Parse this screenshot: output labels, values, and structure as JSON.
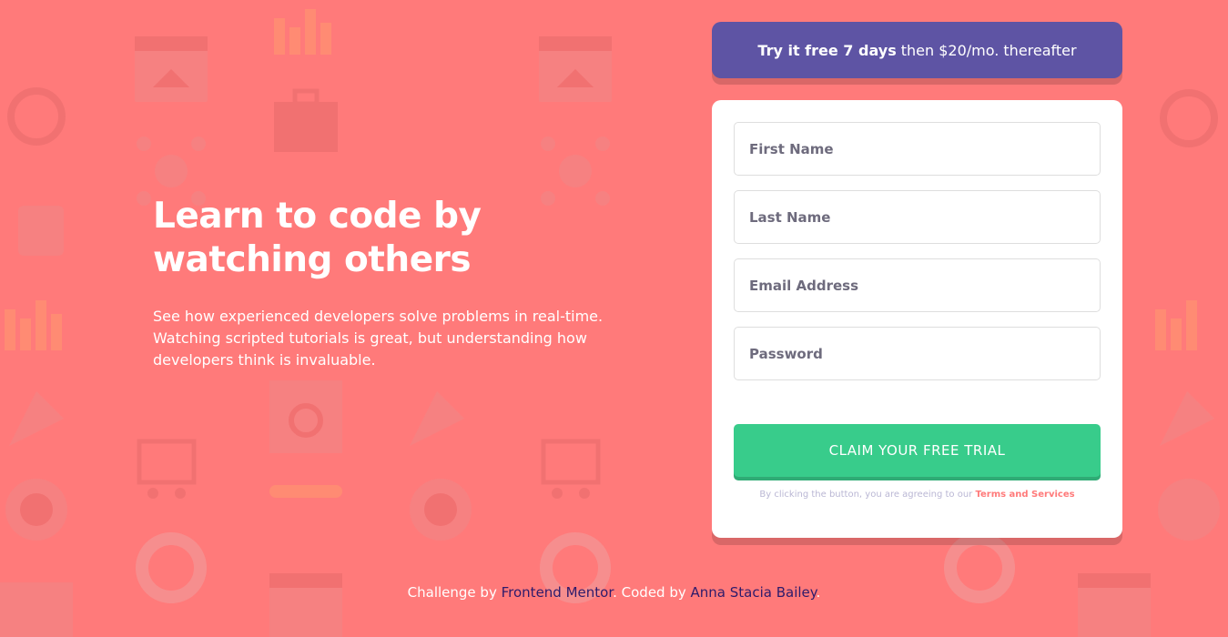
{
  "colors": {
    "background": "#ff7a7a",
    "banner": "#5e54a4",
    "button": "#38cc8b",
    "link_accent": "#ff7a7a"
  },
  "hero": {
    "title": "Learn to code by watching others",
    "description": "See how experienced developers solve problems in real-time. Watching scripted tutorials is great, but understanding how developers think is invaluable."
  },
  "trial_banner": {
    "bold_text": "Try it free 7 days",
    "rest_text": "then $20/mo. thereafter"
  },
  "form": {
    "first_name_placeholder": "First Name",
    "last_name_placeholder": "Last Name",
    "email_placeholder": "Email Address",
    "password_placeholder": "Password",
    "submit_label": "CLAIM YOUR FREE TRIAL",
    "terms_prefix": "By clicking the button, you are agreeing to our",
    "terms_link": "Terms and Services"
  },
  "attribution": {
    "challenge_prefix": "Challenge by",
    "challenge_link": "Frontend Mentor",
    "coded_prefix": ". Coded by",
    "coded_link": "Anna Stacia Bailey",
    "suffix": "."
  },
  "background_icons": [
    "puzzle-icon",
    "browser-home-icon",
    "headset-icon",
    "toolbox-icon",
    "network-icon",
    "thumbs-up-icon",
    "bar-chart-icon",
    "rocket-icon",
    "search-window-icon",
    "cart-icon",
    "globe-gear-icon",
    "key-icon",
    "lifebuoy-icon",
    "calendar-icon"
  ]
}
